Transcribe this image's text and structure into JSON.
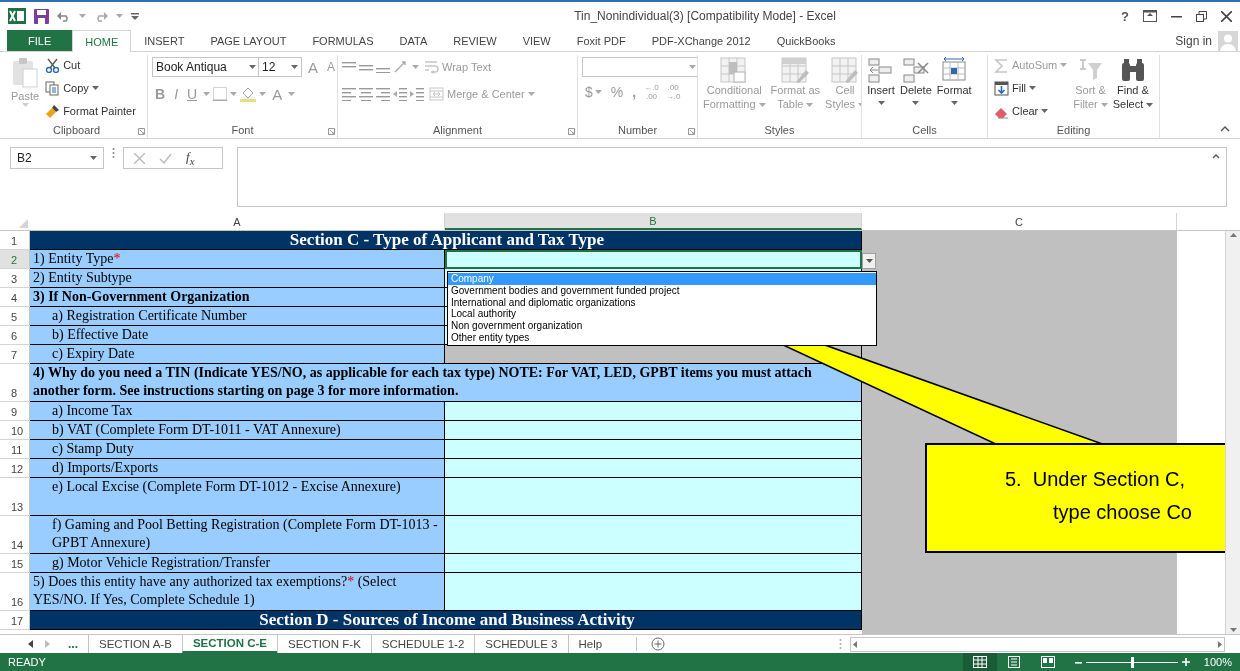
{
  "window": {
    "title": "Tin_Nonindividual(3)  [Compatibility Mode] - Excel",
    "help": "?"
  },
  "ribbon_tabs": [
    {
      "label": "FILE",
      "kind": "file",
      "selected": false
    },
    {
      "label": "HOME",
      "kind": "tab",
      "selected": true
    },
    {
      "label": "INSERT",
      "kind": "tab",
      "selected": false
    },
    {
      "label": "PAGE LAYOUT",
      "kind": "tab",
      "selected": false
    },
    {
      "label": "FORMULAS",
      "kind": "tab",
      "selected": false
    },
    {
      "label": "DATA",
      "kind": "tab",
      "selected": false
    },
    {
      "label": "REVIEW",
      "kind": "tab",
      "selected": false
    },
    {
      "label": "VIEW",
      "kind": "tab",
      "selected": false
    },
    {
      "label": "Foxit PDF",
      "kind": "tab",
      "selected": false
    },
    {
      "label": "PDF-XChange 2012",
      "kind": "tab",
      "selected": false
    },
    {
      "label": "QuickBooks",
      "kind": "tab",
      "selected": false
    }
  ],
  "sign_in": "Sign in",
  "ribbon": {
    "groups": [
      {
        "kind": "clipboard",
        "label": "Clipboard",
        "launcher": true,
        "paste": {
          "label": "Paste",
          "disabled": true
        },
        "items": [
          {
            "label": "Cut",
            "caret": false,
            "disabled": false
          },
          {
            "label": "Copy",
            "caret": true,
            "disabled": false
          },
          {
            "label": "Format Painter",
            "caret": false,
            "disabled": false
          }
        ]
      },
      {
        "kind": "font",
        "label": "Font",
        "launcher": true,
        "font_name": "Book Antiqua",
        "font_size": "12",
        "grow": "A",
        "shrink": "A",
        "styles": [
          "B",
          "I",
          "U"
        ],
        "font_color": "A",
        "disabled": true
      },
      {
        "kind": "alignment",
        "label": "Alignment",
        "launcher": true,
        "items": [
          {
            "label": "Wrap Text",
            "caret": false,
            "disabled": true
          },
          {
            "label": "Merge & Center",
            "caret": true,
            "disabled": true
          }
        ]
      },
      {
        "kind": "number",
        "label": "Number",
        "launcher": true,
        "currency": "$",
        "percent": "%",
        "comma": ",",
        "decimals": [
          {
            "top": "←.0",
            "bottom": ".00"
          },
          {
            "top": ".00",
            "bottom": "→.0"
          }
        ],
        "disabled": true
      },
      {
        "kind": "large",
        "label": "Styles",
        "items": [
          {
            "lines": [
              "Conditional",
              "Formatting"
            ],
            "caret": true,
            "disabled": true
          },
          {
            "lines": [
              "Format as",
              "Table"
            ],
            "caret": true,
            "disabled": true
          },
          {
            "lines": [
              "Cell",
              "Styles"
            ],
            "caret": true,
            "disabled": true
          }
        ]
      },
      {
        "kind": "large",
        "label": "Cells",
        "items": [
          {
            "lines": [
              "Insert"
            ],
            "caret": true,
            "disabled": false
          },
          {
            "lines": [
              "Delete"
            ],
            "caret": true,
            "disabled": false
          },
          {
            "lines": [
              "Format"
            ],
            "caret": true,
            "disabled": false
          }
        ]
      },
      {
        "kind": "editing",
        "label": "Editing",
        "items": [
          {
            "label": "AutoSum",
            "caret": true,
            "disabled": true
          },
          {
            "label": "Fill",
            "caret": true,
            "disabled": false
          },
          {
            "label": "Clear",
            "caret": true,
            "disabled": false
          }
        ],
        "large": [
          {
            "lines": [
              "Sort &",
              "Filter"
            ],
            "caret": true,
            "disabled": true
          },
          {
            "lines": [
              "Find &",
              "Select"
            ],
            "caret": true,
            "disabled": false
          }
        ]
      }
    ]
  },
  "formula_bar": {
    "name_box": "B2",
    "fx": "f$_{x}$"
  },
  "columns": [
    {
      "label": "A",
      "selected": false
    },
    {
      "label": "B",
      "selected": true
    },
    {
      "label": "C",
      "selected": false
    }
  ],
  "rows": [
    {
      "number": "1",
      "kind": "section",
      "text": "Section C - Type of Applicant and Tax Type"
    },
    {
      "number": "2",
      "kind": "field",
      "parts": [
        {
          "text": "1) Entity Type"
        },
        {
          "text": "*",
          "kind": "required"
        }
      ],
      "shaded": false,
      "selected": true
    },
    {
      "number": "3",
      "kind": "field",
      "parts": [
        {
          "text": "2) Entity Subtype"
        }
      ],
      "shaded": false,
      "selected": false
    },
    {
      "number": "4",
      "kind": "heading",
      "parts": [
        {
          "text": "3) If Non-Government Organization"
        }
      ],
      "shaded": false,
      "selected": false,
      "children": [
        {
          "number": "5",
          "kind": "field",
          "parts": [
            {
              "text": "a) Registration Certificate Number"
            }
          ],
          "shaded": false,
          "selected": false
        },
        {
          "number": "6",
          "kind": "field",
          "parts": [
            {
              "text": "b) Effective Date"
            }
          ],
          "shaded": false,
          "selected": false
        },
        {
          "number": "7",
          "kind": "field",
          "parts": [
            {
              "text": "c) Expiry Date"
            }
          ],
          "shaded": true,
          "selected": false
        }
      ]
    },
    {
      "number": "8",
      "kind": "note",
      "parts": [
        {
          "text": "4) Why do you need a TIN (Indicate YES/NO, as applicable for each tax type)  NOTE: For VAT, LED, GPBT items you must attach another form. See instructions starting on page 3 for more information."
        }
      ],
      "selected": false,
      "children": [
        {
          "number": "9",
          "kind": "field",
          "parts": [
            {
              "text": "a) Income Tax"
            }
          ],
          "shaded": false,
          "selected": false
        },
        {
          "number": "10",
          "kind": "field",
          "parts": [
            {
              "text": "b) VAT (Complete Form DT-1011 - VAT Annexure)"
            }
          ],
          "shaded": false,
          "selected": false
        },
        {
          "number": "11",
          "kind": "field",
          "parts": [
            {
              "text": "c) Stamp Duty"
            }
          ],
          "shaded": false,
          "selected": false
        },
        {
          "number": "12",
          "kind": "field",
          "parts": [
            {
              "text": "d) Imports/Exports"
            }
          ],
          "shaded": false,
          "selected": false
        },
        {
          "number": "13",
          "kind": "field",
          "parts": [
            {
              "text": "e) Local Excise (Complete Form DT-1012 - Excise Annexure)"
            }
          ],
          "shaded": false,
          "selected": false
        },
        {
          "number": "14",
          "kind": "field",
          "parts": [
            {
              "text": "f) Gaming and Pool Betting Registration (Complete Form DT-1013 - GPBT Annexure)"
            }
          ],
          "shaded": false,
          "selected": false
        },
        {
          "number": "15",
          "kind": "field",
          "parts": [
            {
              "text": "g) Motor Vehicle Registration/Transfer"
            }
          ],
          "shaded": false,
          "selected": false
        }
      ]
    },
    {
      "number": "16",
      "kind": "field",
      "parts": [
        {
          "text": "5) Does this entity have any authorized tax exemptions?"
        },
        {
          "text": "*",
          "kind": "required"
        },
        {
          "text": " (Select YES/NO. If Yes, Complete Schedule 1)"
        }
      ],
      "shaded": false,
      "selected": false
    },
    {
      "number": "17",
      "kind": "section",
      "text": "Section D - Sources of Income and Business Activity"
    }
  ],
  "dropdown": {
    "items": [
      {
        "label": "Company",
        "selected": true
      },
      {
        "label": "Government bodies and government funded project",
        "selected": false
      },
      {
        "label": "International and diplomatic organizations",
        "selected": false
      },
      {
        "label": "Local authority",
        "selected": false
      },
      {
        "label": "Non government organization",
        "selected": false
      },
      {
        "label": "Other entity types",
        "selected": false
      }
    ]
  },
  "callout": {
    "lines": [
      "5.  Under Section C,",
      "type choose Co"
    ]
  },
  "sheet_tabs": {
    "more": "...",
    "tabs": [
      {
        "label": "SECTION A-B",
        "selected": false
      },
      {
        "label": "SECTION C-E",
        "selected": true
      },
      {
        "label": "SECTION F-K",
        "selected": false
      },
      {
        "label": "SCHEDULE 1-2",
        "selected": false
      },
      {
        "label": "SCHEDULE 3",
        "selected": false
      },
      {
        "label": "Help",
        "selected": false
      }
    ]
  },
  "status_bar": {
    "status": "READY",
    "views": [
      {
        "kind": "normal",
        "selected": true
      },
      {
        "kind": "page_layout",
        "selected": false
      },
      {
        "kind": "page_break",
        "selected": false
      }
    ],
    "zoom": {
      "level": 0.5,
      "reading": "100%"
    }
  }
}
